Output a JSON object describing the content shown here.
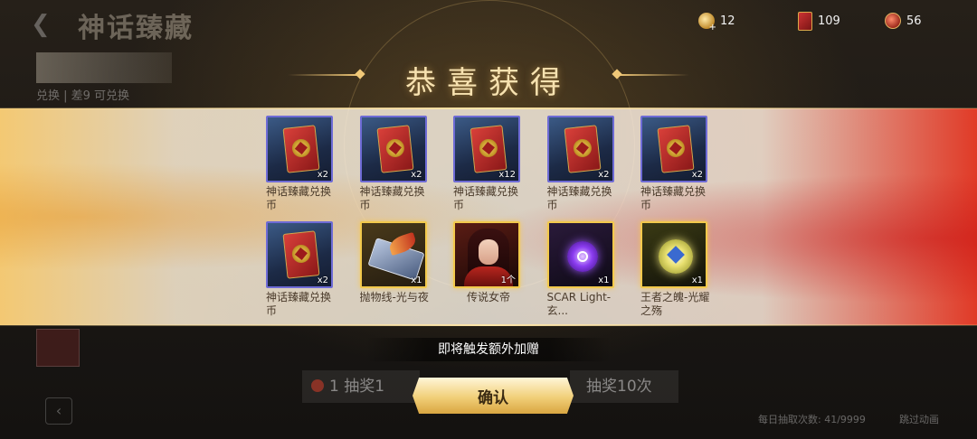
{
  "background": {
    "title": "神话臻藏",
    "back_icon": "chevron-left-icon",
    "banner_text": "兑换 | 差9 可兑换",
    "draw_one_label": "1  抽奖1",
    "draw_ten_label": "抽奖10次",
    "daily_text": "每日抽取次数: 41/9999",
    "skip_text": "跳过动画"
  },
  "currency": [
    {
      "icon": "gold-coin-plus-icon",
      "value": "12"
    },
    {
      "icon": "red-card-icon",
      "value": "109"
    },
    {
      "icon": "red-coin-icon",
      "value": "56"
    }
  ],
  "dialog": {
    "heading": "恭喜获得",
    "bonus_text": "即将触发额外加赠",
    "confirm_label": "确认"
  },
  "rewards": [
    {
      "name": "神话臻藏兑换币",
      "qty": "x2",
      "art": "card-icon",
      "rarity": "epic"
    },
    {
      "name": "神话臻藏兑换币",
      "qty": "x2",
      "art": "card-icon",
      "rarity": "epic"
    },
    {
      "name": "神话臻藏兑换币",
      "qty": "x12",
      "art": "card-icon",
      "rarity": "epic"
    },
    {
      "name": "神话臻藏兑换币",
      "qty": "x2",
      "art": "card-icon",
      "rarity": "epic"
    },
    {
      "name": "神话臻藏兑换币",
      "qty": "x2",
      "art": "card-icon",
      "rarity": "epic"
    },
    {
      "name": "神话臻藏兑换币",
      "qty": "x2",
      "art": "card-icon",
      "rarity": "epic"
    },
    {
      "name": "抛物线-光与夜",
      "qty": "x1",
      "art": "parabola-icon",
      "rarity": "legendary"
    },
    {
      "name": "传说女帝",
      "qty": "1个",
      "art": "character-icon",
      "rarity": "legendary"
    },
    {
      "name": "SCAR Light-玄...",
      "qty": "x1",
      "art": "purple-emblem-icon",
      "rarity": "legendary"
    },
    {
      "name": "王者之魄-光耀之殇",
      "qty": "x1",
      "art": "gold-emblem-icon",
      "rarity": "legendary"
    }
  ],
  "colors": {
    "epic_border": "#6e6bd6",
    "legendary_border": "#f2c94c",
    "heading": "#f7e2b0",
    "confirm_bg": "#f1cf79"
  }
}
